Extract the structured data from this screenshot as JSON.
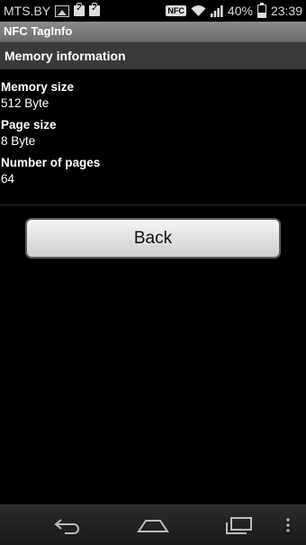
{
  "status_bar": {
    "carrier": "MTS.BY",
    "nfc": "NFC",
    "battery": "40%",
    "time": "23:39"
  },
  "app": {
    "title": "NFC TagInfo"
  },
  "section": {
    "title": "Memory information"
  },
  "fields": [
    {
      "label": "Memory size",
      "value": "512 Byte"
    },
    {
      "label": "Page size",
      "value": "8 Byte"
    },
    {
      "label": "Number of pages",
      "value": "64"
    }
  ],
  "back_button": {
    "label": "Back"
  },
  "navigation": {
    "back": "back-icon",
    "home": "home-icon",
    "recents": "recent-apps-icon",
    "menu": "overflow-menu-icon"
  }
}
